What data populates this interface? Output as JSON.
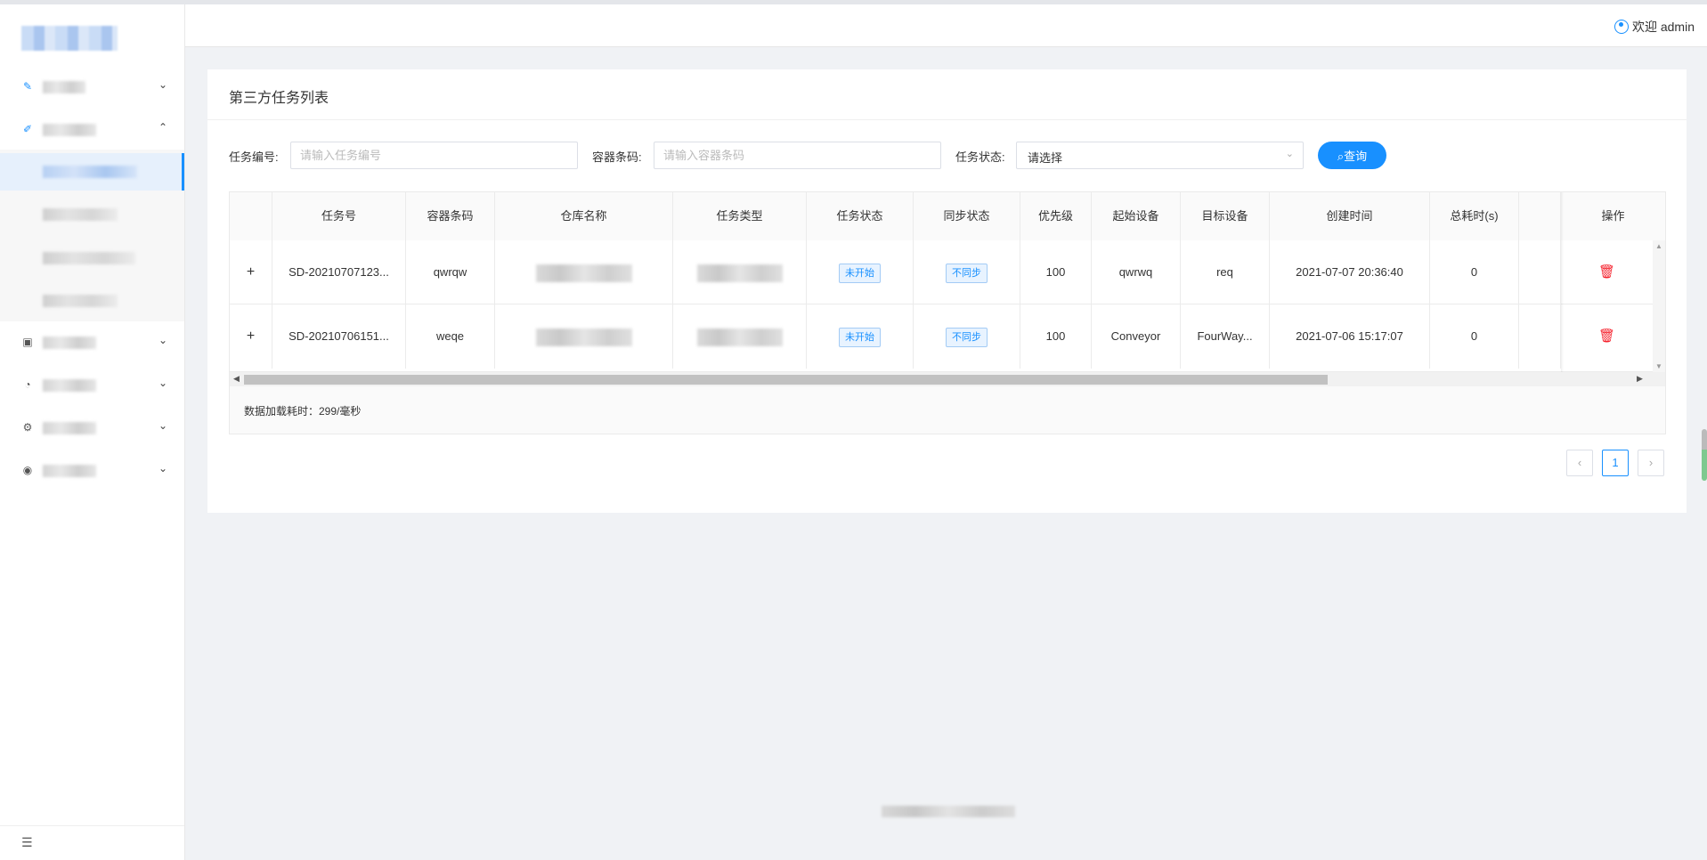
{
  "header": {
    "welcome": "欢迎 admin"
  },
  "sidebar": {
    "menu_icons": [
      "wrench-icon",
      "edit-icon",
      "clipboard-icon",
      "dashboard-icon",
      "settings-icon",
      "eye-icon"
    ],
    "collapse_icon": "menu-fold-icon"
  },
  "page": {
    "title": "第三方任务列表"
  },
  "filters": {
    "task_no_label": "任务编号:",
    "task_no_placeholder": "请输入任务编号",
    "container_label": "容器条码:",
    "container_placeholder": "请输入容器条码",
    "status_label": "任务状态:",
    "status_value": "请选择",
    "query_button": "查询"
  },
  "table": {
    "columns": {
      "task_no": "任务号",
      "container": "容器条码",
      "warehouse": "仓库名称",
      "task_type": "任务类型",
      "task_status": "任务状态",
      "sync_status": "同步状态",
      "priority": "优先级",
      "start_device": "起始设备",
      "target_device": "目标设备",
      "created_at": "创建时间",
      "total_time": "总耗时(s)",
      "actions": "操作"
    },
    "rows": [
      {
        "expand": "+",
        "task_no": "SD-20210707123...",
        "container": "qwrqw",
        "task_status": "未开始",
        "sync_status": "不同步",
        "priority": "100",
        "start_device": "qwrwq",
        "target_device": "req",
        "created_at": "2021-07-07 20:36:40",
        "total_time": "0"
      },
      {
        "expand": "+",
        "task_no": "SD-20210706151...",
        "container": "weqe",
        "task_status": "未开始",
        "sync_status": "不同步",
        "priority": "100",
        "start_device": "Conveyor",
        "target_device": "FourWay...",
        "created_at": "2021-07-06 15:17:07",
        "total_time": "0"
      }
    ],
    "load_time": "数据加载耗时：299/毫秒"
  },
  "pagination": {
    "prev": "‹",
    "current": "1",
    "next": "›"
  },
  "colors": {
    "primary": "#1890ff",
    "danger": "#f5222d",
    "background": "#f0f2f5"
  }
}
